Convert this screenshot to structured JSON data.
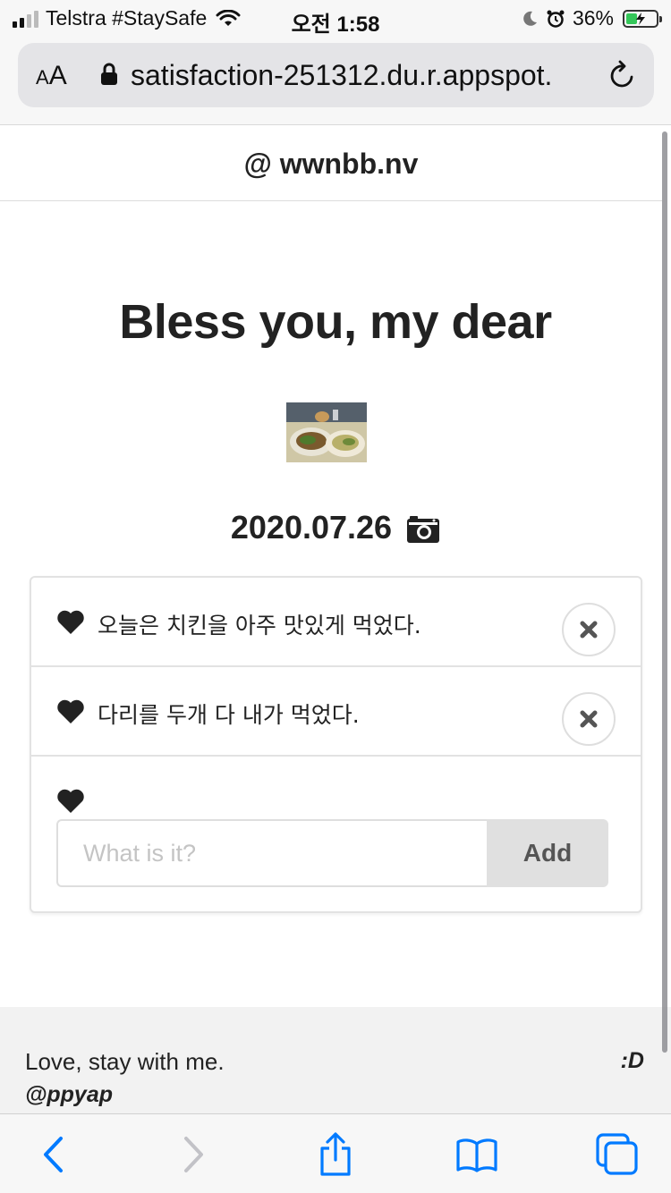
{
  "status_bar": {
    "carrier": "Telstra #StaySafe",
    "time": "오전 1:58",
    "battery": "36%",
    "battery_level": 0.36,
    "icons": [
      "signal-icon",
      "wifi-icon",
      "moon-icon",
      "alarm-icon",
      "battery-icon"
    ]
  },
  "browser": {
    "aa_label": "AA",
    "url": "satisfaction-251312.du.r.appspot.",
    "icons": [
      "lock-icon",
      "reload-icon"
    ]
  },
  "site": {
    "header": "@ wwnbb.nv",
    "headline": "Bless you, my dear",
    "date": "2020.07.26",
    "date_icon": "camera-icon"
  },
  "entries": [
    {
      "text": "오늘은 치킨을 아주 맛있게 먹었다."
    },
    {
      "text": "다리를 두개 다 내가 먹었다."
    }
  ],
  "add_form": {
    "placeholder": "What is it?",
    "value": "",
    "button_label": "Add"
  },
  "footer": {
    "message": "Love, stay with me.",
    "handle": "@ppyap",
    "smiley": ":D"
  },
  "toolbar": {
    "icons": [
      "back-icon",
      "forward-icon",
      "share-icon",
      "bookmarks-icon",
      "tabs-icon"
    ]
  },
  "colors": {
    "ios_blue": "#007aff",
    "text": "#222222",
    "battery_green": "#34c759",
    "footer_bg": "#f2f2f2",
    "add_button_bg": "#e0e0e0"
  }
}
